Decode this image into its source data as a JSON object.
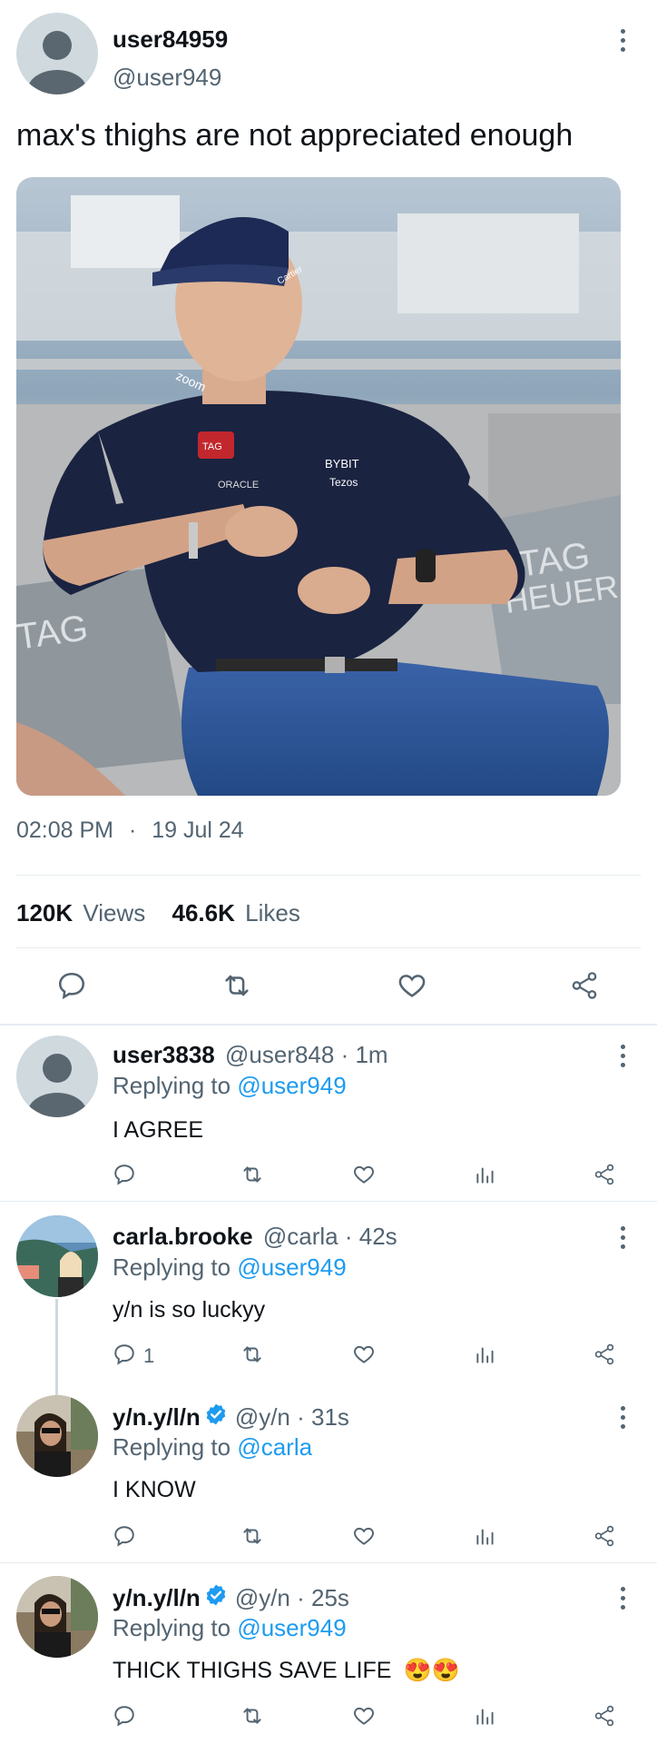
{
  "post": {
    "author_name": "user84959",
    "author_handle": "@user949",
    "text": "max's thighs are not appreciated enough",
    "time": "02:08 PM",
    "separator": "·",
    "date": "19 Jul 24",
    "views_count": "120K",
    "views_label": "Views",
    "likes_count": "46.6K",
    "likes_label": "Likes",
    "photo_logos": {
      "tag": "TAG",
      "heuer": "HEUER",
      "shirt_tag": "TAG",
      "shirt_oracle": "ORACLE",
      "shirt_bybit": "BYBIT",
      "shirt_tezos": "Tezos",
      "shirt_zoom": "zoom",
      "cap_brand": "Cartier"
    }
  },
  "replies": [
    {
      "name": "user3838",
      "handle_time": "@user848 · 1m",
      "replying_prefix": "Replying to",
      "replying_to": "@user949",
      "text": "I AGREE",
      "reply_count": "",
      "verified": false
    },
    {
      "name": "carla.brooke",
      "handle_time": "@carla · 42s",
      "replying_prefix": "Replying to",
      "replying_to": "@user949",
      "text": "y/n is so luckyy",
      "reply_count": "1",
      "verified": false
    },
    {
      "name": "y/n.y/l/n",
      "handle_time": "@y/n · 31s",
      "replying_prefix": "Replying to",
      "replying_to": "@carla",
      "text": "I KNOW",
      "reply_count": "",
      "verified": true
    },
    {
      "name": "y/n.y/l/n",
      "handle_time": "@y/n · 25s",
      "replying_prefix": "Replying to",
      "replying_to": "@user949",
      "text": "THICK THIGHS SAVE LIFE",
      "emoji": "😍😍",
      "reply_count": "",
      "verified": true
    }
  ],
  "colors": {
    "link": "#1d9bf0",
    "muted": "#536471",
    "divider": "#e6ecf0",
    "verified": "#1d9bf0"
  }
}
